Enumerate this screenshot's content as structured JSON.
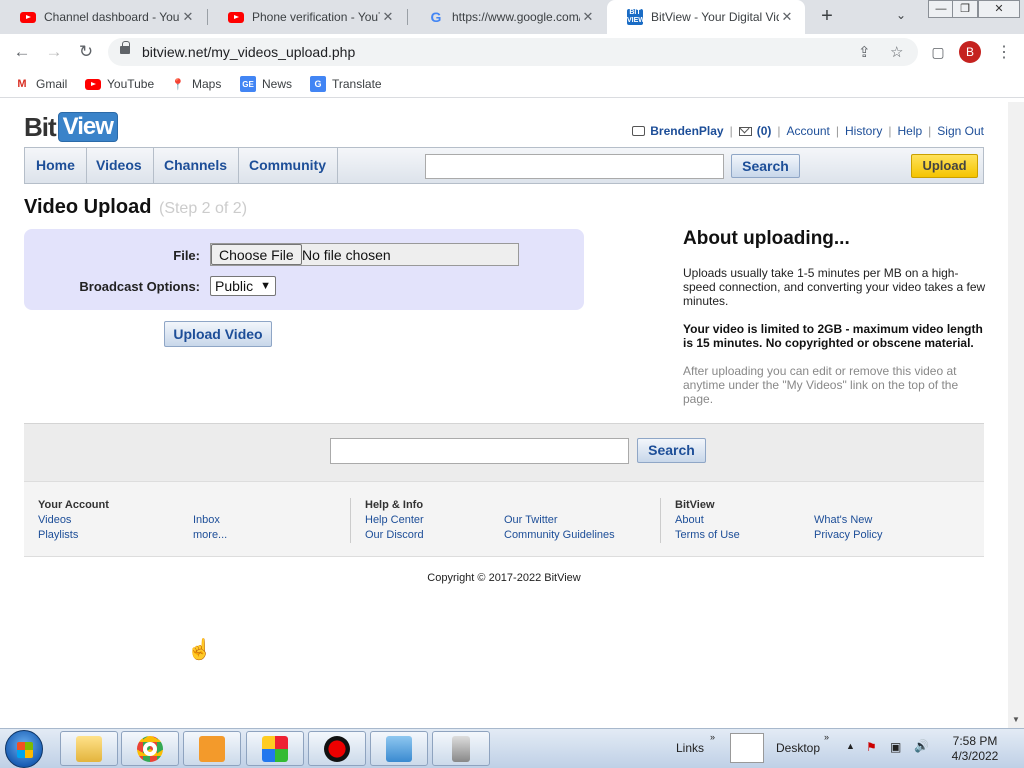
{
  "browser": {
    "tabs": [
      {
        "title": "Channel dashboard - YouTube",
        "favicon": "youtube-icon",
        "active": false
      },
      {
        "title": "Phone verification - YouTube",
        "favicon": "youtube-icon",
        "active": false
      },
      {
        "title": "https://www.google.com/",
        "favicon": "google-icon",
        "active": false
      },
      {
        "title": "BitView - Your Digital Video Repository",
        "favicon": "bitview-icon",
        "active": true
      }
    ],
    "url": "bitview.net/my_videos_upload.php",
    "profile_initial": "B",
    "bookmarks": [
      {
        "label": "Gmail",
        "icon": "gmail-icon"
      },
      {
        "label": "YouTube",
        "icon": "youtube-icon"
      },
      {
        "label": "Maps",
        "icon": "maps-icon"
      },
      {
        "label": "News",
        "icon": "news-icon"
      },
      {
        "label": "Translate",
        "icon": "translate-icon"
      }
    ]
  },
  "site": {
    "logo_bit": "Bit",
    "logo_view": "View",
    "user": {
      "username": "BrendenPlay",
      "inbox_count": "(0)",
      "links": [
        "Account",
        "History",
        "Help",
        "Sign Out"
      ]
    },
    "nav": [
      "Home",
      "Videos",
      "Channels",
      "Community"
    ],
    "search_button": "Search",
    "upload_button": "Upload"
  },
  "upload": {
    "title": "Video Upload",
    "step": "(Step 2 of 2)",
    "file_label": "File:",
    "choose_file": "Choose File",
    "no_file": "No file chosen",
    "broadcast_label": "Broadcast Options:",
    "broadcast_value": "Public",
    "submit": "Upload Video"
  },
  "about": {
    "heading": "About uploading...",
    "p1": "Uploads usually take 1-5 minutes per MB on a high-speed connection, and converting your video takes a few minutes.",
    "p2": "Your video is limited to 2GB - maximum video length is 15 minutes. No copyrighted or obscene material.",
    "p3": "After uploading you can edit or remove this video at anytime under the \"My Videos\" link on the top of the page."
  },
  "footer": {
    "search_button": "Search",
    "columns": [
      {
        "heading": "Your Account",
        "links": [
          "Videos",
          "Playlists"
        ],
        "links2": [
          "Inbox",
          "more..."
        ]
      },
      {
        "heading": "Help & Info",
        "links": [
          "Help Center",
          "Our Discord"
        ],
        "links2": [
          "Our Twitter",
          "Community Guidelines"
        ]
      },
      {
        "heading": "BitView",
        "links": [
          "About",
          "Terms of Use"
        ],
        "links2": [
          "What's New",
          "Privacy Policy"
        ]
      }
    ],
    "copyright": "Copyright © 2017-2022 BitView"
  },
  "taskbar": {
    "links_label": "Links",
    "desktop_label": "Desktop",
    "time": "7:58 PM",
    "date": "4/3/2022"
  },
  "colors": {
    "link": "#1d4e98",
    "form_bg": "#e3e3fb",
    "upload_yellow": "#f5c400"
  }
}
